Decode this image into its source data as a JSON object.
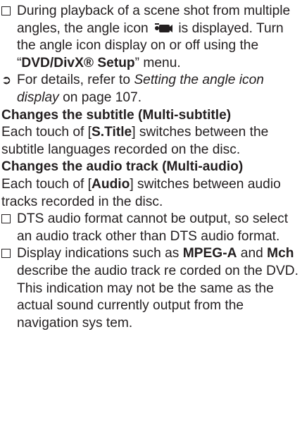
{
  "notes": {
    "angle": {
      "part1": "During playback of a scene shot from multiple angles, the angle icon",
      "part2": "is displayed. Turn the angle icon display on or off using the “",
      "menu_name": "DVD/DivX® Setup",
      "part3": "” menu."
    },
    "ref_angle": {
      "prefix": "For details, refer to ",
      "title": "Setting the angle icon display",
      "suffix": " on page 107."
    }
  },
  "subtitle_section": {
    "heading": "Changes the subtitle (Multi-subtitle)",
    "text_before": "Each touch of [",
    "key": "S.Title",
    "text_after": "] switches between the subtitle languages recorded on the disc."
  },
  "audio_section": {
    "heading": "Changes the audio track (Multi-audio)",
    "text_before": "Each touch of [",
    "key": "Audio",
    "text_after": "] switches between audio tracks recorded in the disc.",
    "note_dts": "DTS audio format cannot be output, so select an audio track other than DTS audio format.",
    "note_display": {
      "part1": "Display indications such as ",
      "term1": "MPEG-A",
      "part2": " and ",
      "term2": "Mch",
      "part3": " describe the audio track re corded on the DVD. This indication may not be the same as the actual sound currently output from the navigation sys tem."
    }
  },
  "icons": {
    "note_marker": "checkbox-square-icon",
    "reference_marker": "right-arrow-icon",
    "angle": "camera-angle-icon"
  }
}
